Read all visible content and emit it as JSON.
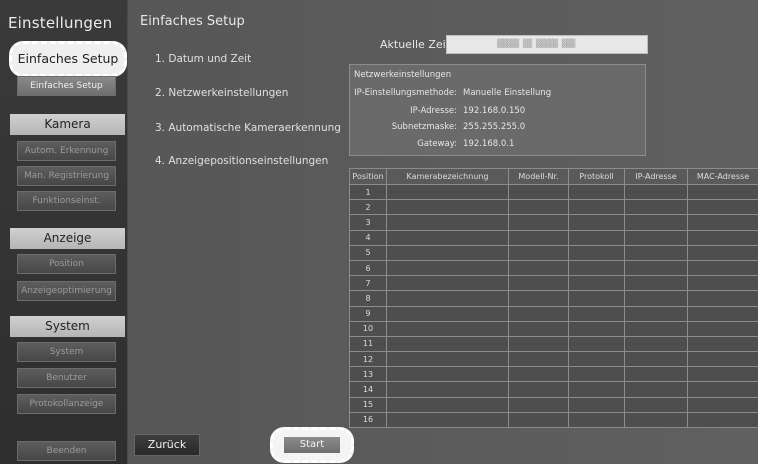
{
  "sidebar": {
    "title": "Einstellungen",
    "highlighted_item": "Einfaches Setup",
    "setup_item": "Einfaches Setup",
    "sections": {
      "kamera": {
        "label": "Kamera",
        "items": [
          "Autom. Erkennung",
          "Man. Registrierung",
          "Funktionseinst."
        ]
      },
      "anzeige": {
        "label": "Anzeige",
        "items": [
          "Position",
          "Anzeigeoptimierung"
        ]
      },
      "system": {
        "label": "System",
        "items": [
          "System",
          "Benutzer",
          "Protokollanzeige"
        ]
      }
    },
    "exit_label": "Beenden"
  },
  "main": {
    "title": "Einfaches Setup",
    "steps": [
      "1. Datum und Zeit",
      "2. Netzwerkeinstellungen",
      "3. Automatische Kameraerkennung",
      "4. Anzeigepositionseinstellungen"
    ],
    "time": {
      "label": "Aktuelle Zeit",
      "value": "▓▓▓▓▓ ▓▓ ▓▓▓▓▓ ▓▓▓"
    },
    "network": {
      "title": "Netzwerkeinstellungen",
      "rows": [
        {
          "label": "IP-Einstellungsmethode:",
          "value": "Manuelle Einstellung"
        },
        {
          "label": "IP-Adresse:",
          "value": "192.168.0.150"
        },
        {
          "label": "Subnetzmaske:",
          "value": "255.255.255.0"
        },
        {
          "label": "Gateway:",
          "value": "192.168.0.1"
        }
      ]
    },
    "table": {
      "headers": [
        "Position",
        "Kamerabezeichnung",
        "Modell-Nr.",
        "Protokoll",
        "IP-Adresse",
        "MAC-Adresse"
      ],
      "positions": [
        "1",
        "2",
        "3",
        "4",
        "5",
        "6",
        "7",
        "8",
        "9",
        "10",
        "11",
        "12",
        "13",
        "14",
        "15",
        "16"
      ]
    },
    "back_label": "Zurück",
    "start_label": "Start"
  }
}
